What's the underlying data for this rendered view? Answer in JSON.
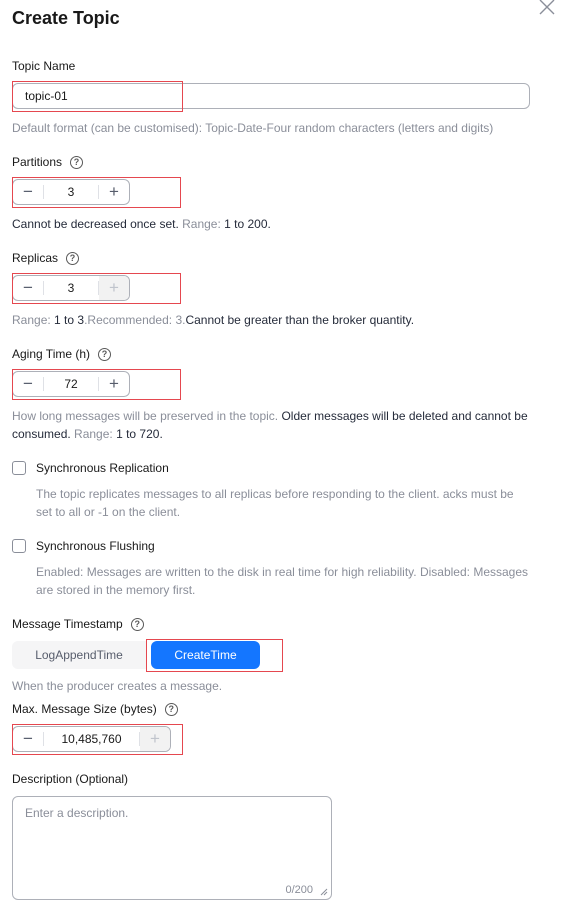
{
  "dialog": {
    "title": "Create Topic"
  },
  "topic_name": {
    "label": "Topic Name",
    "value": "topic-01",
    "hint": "Default format (can be customised): Topic-Date-Four random characters (letters and digits)"
  },
  "partitions": {
    "label": "Partitions",
    "value": "3",
    "hint_part1": "Cannot be decreased once set.",
    "hint_part2": " Range: ",
    "hint_part3": "1 to 200",
    "hint_part4": "."
  },
  "replicas": {
    "label": "Replicas",
    "value": "3",
    "hint_part1": "Range: ",
    "hint_part2": "1 to 3",
    "hint_part3": ".Recommended: 3.",
    "hint_part4": "Cannot be greater than the broker quantity."
  },
  "aging_time": {
    "label": "Aging Time (h)",
    "value": "72",
    "hint_part1": "How long messages will be preserved in the topic. ",
    "hint_part2": "Older messages will be deleted and cannot be",
    "hint_part3": "consumed.",
    "hint_part4": " Range: ",
    "hint_part5": "1 to 720",
    "hint_part6": "."
  },
  "sync_replication": {
    "label": "Synchronous Replication",
    "checked": false,
    "hint_line1": "The topic replicates messages to all replicas before responding to the client. acks must be",
    "hint_line2": "set to all or -1 on the client."
  },
  "sync_flushing": {
    "label": "Synchronous Flushing",
    "checked": false,
    "hint_line1": "Enabled: Messages are written to the disk in real time for high reliability. Disabled: Messages",
    "hint_line2": "are stored in the memory first."
  },
  "message_timestamp": {
    "label": "Message Timestamp",
    "options": [
      "LogAppendTime",
      "CreateTime"
    ],
    "selected": "CreateTime",
    "hint": "When the producer creates a message."
  },
  "max_message_size": {
    "label": "Max. Message Size (bytes)",
    "value": "10,485,760"
  },
  "description": {
    "label": "Description (Optional)",
    "placeholder": "Enter a description.",
    "counter": "0/200"
  },
  "icons": {
    "close": "close-icon",
    "help": "help-circle-icon",
    "minus": "minus-icon",
    "plus": "plus-icon",
    "resize": "resize-grip-icon"
  },
  "colors": {
    "accent": "#1476ff",
    "highlight": "#e5474f"
  }
}
